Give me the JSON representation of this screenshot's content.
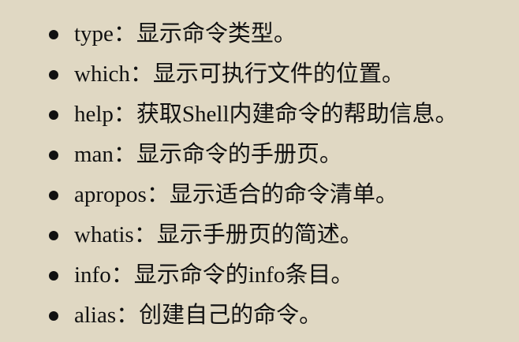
{
  "document": {
    "items": [
      {
        "text": "type：显示命令类型。"
      },
      {
        "text": "which：显示可执行文件的位置。"
      },
      {
        "text": "help：获取Shell内建命令的帮助信息。"
      },
      {
        "text": "man：显示命令的手册页。"
      },
      {
        "text": "apropos：显示适合的命令清单。"
      },
      {
        "text": "whatis：显示手册页的简述。"
      },
      {
        "text": "info：显示命令的info条目。"
      },
      {
        "text": "alias：创建自己的命令。"
      }
    ]
  }
}
